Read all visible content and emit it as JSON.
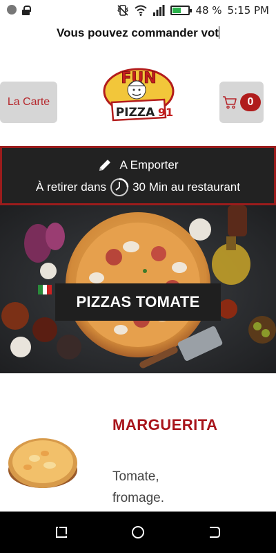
{
  "status_bar": {
    "battery_percent": "48 %",
    "battery_level": 0.48,
    "time": "5:15 PM",
    "icons": [
      "notification-dot-icon",
      "lock-icon",
      "vibrate-icon",
      "wifi-icon",
      "signal-icon",
      "battery-icon"
    ]
  },
  "marquee": {
    "text": "Vous pouvez commander vot"
  },
  "header": {
    "menu_button_label": "La Carte",
    "logo_top_text": "FUN",
    "logo_bottom_text": "PIZZA",
    "logo_number": "91",
    "cart_count": "0"
  },
  "order_mode": {
    "mode_label": "A Emporter",
    "pickup_prefix": "À retirer dans",
    "pickup_suffix": "30 Min au restaurant"
  },
  "category": {
    "title": "PIZZAS TOMATE"
  },
  "product": {
    "name": "MARGUERITA",
    "description": "Tomate, fromage."
  },
  "colors": {
    "accent_red": "#a8141b",
    "banner_bg": "#222222",
    "button_gray": "#d6d6d6"
  }
}
